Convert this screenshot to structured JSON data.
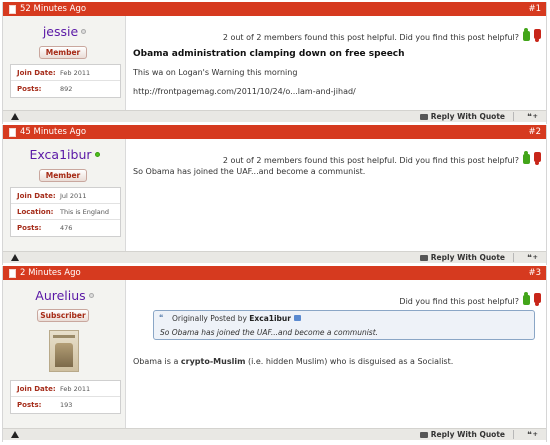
{
  "posts": [
    {
      "time": "52 Minutes Ago",
      "number": "#1",
      "username": "jessie",
      "online": false,
      "rank": "Member",
      "info": [
        {
          "label": "Join Date:",
          "value": "Feb 2011"
        },
        {
          "label": "Posts:",
          "value": "892"
        }
      ],
      "helpful": "2 out of 2 members found this post helpful. Did you find this post helpful?",
      "title": "Obama administration clamping down on free speech",
      "body": [
        "This wa on Logan's Warning this morning",
        "http://frontpagemag.com/2011/10/24/o...lam-and-jihad/"
      ],
      "reply": "Reply With Quote"
    },
    {
      "time": "45 Minutes Ago",
      "number": "#2",
      "username": "Exca1ibur",
      "online": true,
      "rank": "Member",
      "info": [
        {
          "label": "Join Date:",
          "value": "Jul 2011"
        },
        {
          "label": "Location:",
          "value": "This is England"
        },
        {
          "label": "Posts:",
          "value": "476"
        }
      ],
      "helpful": "2 out of 2 members found this post helpful. Did you find this post helpful?",
      "body": [
        "So Obama has joined the UAF...and become a communist."
      ],
      "reply": "Reply With Quote"
    },
    {
      "time": "2 Minutes Ago",
      "number": "#3",
      "username": "Aurelius",
      "online": false,
      "rank": "Subscriber",
      "info": [
        {
          "label": "Join Date:",
          "value": "Feb 2011"
        },
        {
          "label": "Posts:",
          "value": "193"
        }
      ],
      "helpful": "Did you find this post helpful?",
      "quote": {
        "prefix": "Originally Posted by",
        "author": "Exca1ibur",
        "text": "So Obama has joined the UAF...and become a communist."
      },
      "body_parts": {
        "before": "Obama is a ",
        "bold": "crypto-Muslim",
        "after": " (i.e. hidden Muslim) who is disguised as a Socialist."
      },
      "reply": "Reply With Quote"
    }
  ],
  "colors": {
    "header_red": "#d63a1f",
    "username_purple": "#5a18a6",
    "label_red": "#a52c1a",
    "thumb_up": "#43a51a",
    "thumb_down": "#c8261a"
  },
  "icons": {
    "header": "document-icon",
    "footer_left": "warning-icon",
    "reply": "reply-quote-icon",
    "multiquote": "multiquote-icon"
  }
}
